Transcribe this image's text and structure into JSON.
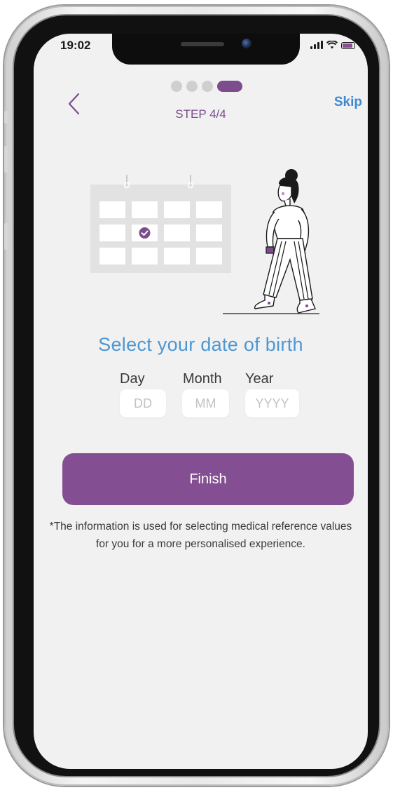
{
  "status_bar": {
    "time": "19:02",
    "battery_color": "#8a4e93"
  },
  "header": {
    "back_icon": "chevron-left-icon",
    "step_label": "STEP 4/4",
    "skip_label": "Skip",
    "progress": {
      "current": 4,
      "total": 4
    }
  },
  "illustration": {
    "calendar_icon": "calendar-check-icon",
    "person_icon": "woman-walking-illustration"
  },
  "title": "Select your date of birth",
  "fields": {
    "day": {
      "label": "Day",
      "placeholder": "DD",
      "value": ""
    },
    "month": {
      "label": "Month",
      "placeholder": "MM",
      "value": ""
    },
    "year": {
      "label": "Year",
      "placeholder": "YYYY",
      "value": ""
    }
  },
  "finish_label": "Finish",
  "note": "*The information is used for selecting medical reference values for you for a more personalised experience.",
  "colors": {
    "accent": "#834f92",
    "link": "#3d8ad0",
    "title": "#4d97d3",
    "background": "#f1f1f1"
  }
}
